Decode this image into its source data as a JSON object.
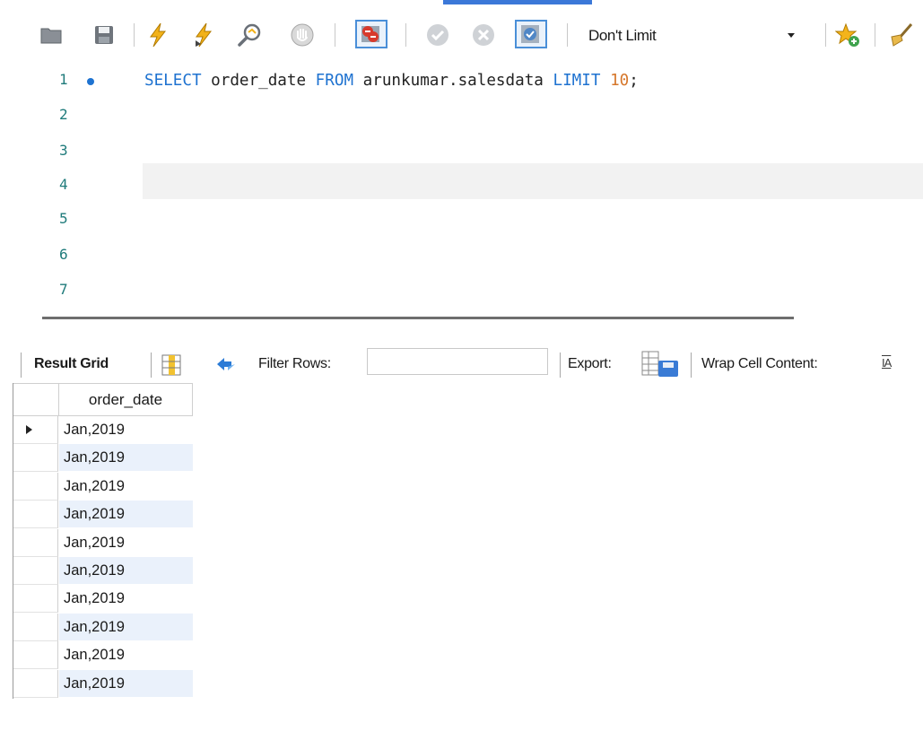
{
  "toolbar": {
    "buttons": [
      {
        "name": "open-folder-icon",
        "kind": "folder"
      },
      {
        "name": "save-icon",
        "kind": "save"
      },
      {
        "name": "execute-icon",
        "kind": "bolt"
      },
      {
        "name": "execute-current-icon",
        "kind": "bolt-cursor"
      },
      {
        "name": "explain-icon",
        "kind": "magnifier"
      },
      {
        "name": "stop-icon",
        "kind": "hand"
      },
      {
        "name": "toggle-error-stop-icon",
        "kind": "error-stop"
      },
      {
        "name": "commit-icon",
        "kind": "check"
      },
      {
        "name": "rollback-icon",
        "kind": "x-circle"
      },
      {
        "name": "autocommit-toggle-icon",
        "kind": "autocommit"
      },
      {
        "name": "add-snippet-icon",
        "kind": "star"
      },
      {
        "name": "beautify-icon",
        "kind": "broom"
      }
    ],
    "limit_value": "Don't Limit"
  },
  "editor": {
    "line_numbers": [
      "1",
      "2",
      "3",
      "4",
      "5",
      "6",
      "7"
    ],
    "query": {
      "kw_select": "SELECT",
      "column": " order_date ",
      "kw_from": "FROM",
      "table": " arunkumar.salesdata ",
      "kw_limit": "LIMIT",
      "space": " ",
      "limit_num": "10",
      "terminator": ";"
    },
    "current_line": 4
  },
  "result": {
    "result_grid_label": "Result Grid",
    "filter_rows_label": "Filter Rows:",
    "filter_value": "",
    "export_label": "Export:",
    "wrap_label": "Wrap Cell Content:",
    "wrap_icon_text": "IA",
    "column_header": "order_date",
    "rows": [
      "Jan,2019",
      "Jan,2019",
      "Jan,2019",
      "Jan,2019",
      "Jan,2019",
      "Jan,2019",
      "Jan,2019",
      "Jan,2019",
      "Jan,2019",
      "Jan,2019"
    ],
    "selected_row": 0
  },
  "colors": {
    "keyword": "#1e72d0",
    "number": "#d6772b",
    "line_number": "#1f7b7b",
    "row_alt": "#eaf1fb",
    "accent": "#3b78d8"
  }
}
